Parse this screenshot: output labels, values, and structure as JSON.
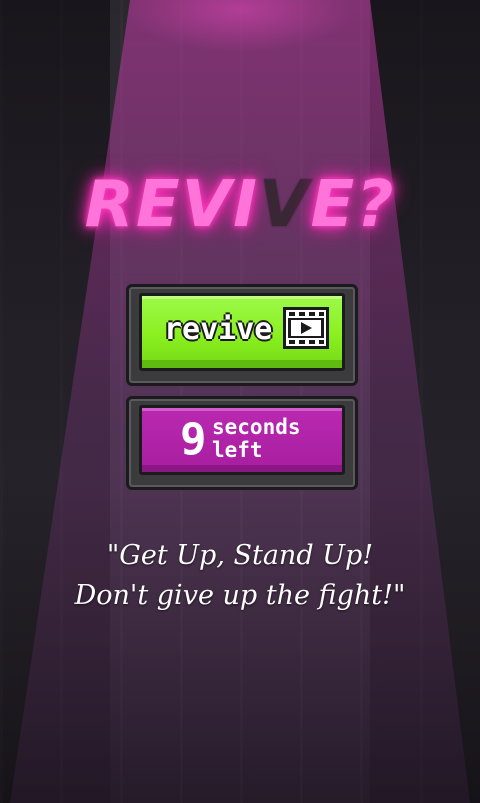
{
  "title": {
    "part1": "REVI",
    "part2": "V",
    "part3": "E?"
  },
  "revive_button": {
    "label": "revive",
    "icon": "film-play-icon"
  },
  "timer": {
    "seconds": "9",
    "line1": "seconds",
    "line2": "left"
  },
  "quote": {
    "line1": "\"Get Up, Stand Up!",
    "line2": "Don't give up the fight!\""
  },
  "colors": {
    "neon_pink": "#ff74d8",
    "revive_green": "#8bf01f",
    "timer_purple": "#a81ea0"
  }
}
